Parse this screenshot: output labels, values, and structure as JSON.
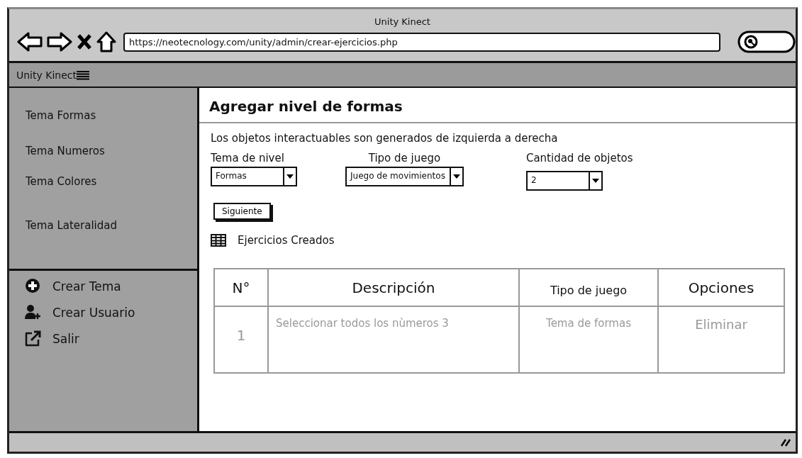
{
  "window": {
    "title": "Unity Kinect",
    "url": "https://neotecnology.com/unity/admin/crear-ejercicios.php"
  },
  "navbar": {
    "brand": "Unity Kinect"
  },
  "sidebar": {
    "items": [
      "Tema Formas",
      "Tema Numeros",
      "Tema Colores",
      "Tema Lateralidad"
    ],
    "actions": [
      {
        "kind": "add",
        "label": "Crear Tema"
      },
      {
        "kind": "add-user",
        "label": "Crear Usuario"
      },
      {
        "kind": "exit",
        "label": "Salir"
      }
    ]
  },
  "content": {
    "heading": "Agregar nivel de formas",
    "description": "Los objetos interactuables son generados de izquierda a derecha",
    "fields": [
      {
        "label": "Tema de nivel",
        "value": "Formas"
      },
      {
        "label": "Tipo de juego",
        "value": "Juego de movimientos"
      },
      {
        "label": "Cantidad de objetos",
        "value": "2"
      }
    ],
    "button": "Siguiente",
    "section_title": "Ejercicios Creados",
    "table": {
      "columns": [
        "N°",
        "Descripción",
        "Tipo de juego",
        "Opciones"
      ],
      "rows": [
        [
          "1",
          "Seleccionar todos los nùmeros 3",
          "Tema de formas",
          "Eliminar"
        ]
      ]
    }
  }
}
